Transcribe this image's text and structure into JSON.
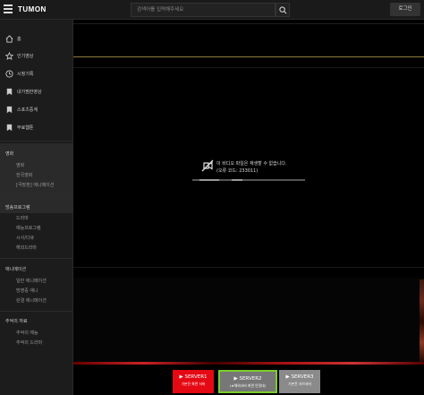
{
  "header": {
    "logo": "TUMON",
    "search_placeholder": "검색어를 입력해주세요",
    "login": "로그인"
  },
  "sidebar": {
    "items": [
      {
        "label": "홈",
        "icon": "home-icon"
      },
      {
        "label": "인기영상",
        "icon": "star-icon"
      },
      {
        "label": "시청기록",
        "icon": "clock-icon"
      },
      {
        "label": "내가찜한영상",
        "icon": "bookmark-icon"
      },
      {
        "label": "스포츠중계",
        "icon": "bookmark-icon"
      },
      {
        "label": "무료웹툰",
        "icon": "bookmark-icon"
      }
    ],
    "sections": [
      {
        "title": "영화",
        "items": [
          "영화",
          "한국영화",
          "[극장판] 애니메이션"
        ]
      },
      {
        "title": "방송프로그램",
        "items": [
          "드라마",
          "예능프로그램",
          "시사/다큐",
          "해외드라마"
        ]
      },
      {
        "title": "애니메이션",
        "items": [
          "일반 애니메이션",
          "방영중 애니",
          "완결 애니메이션"
        ]
      },
      {
        "title": "추억의 자료",
        "items": [
          "추억의 예능",
          "추억의 드라마"
        ]
      }
    ]
  },
  "player": {
    "error_line1": "이 비디오 파일은 재생할 수 없습니다.",
    "error_line2": "(오류 코드: 233011)"
  },
  "servers": [
    {
      "label": "SERVER1",
      "sub": "기본전 화면 서버"
    },
    {
      "label": "SERVER2",
      "sub": "(★해외서버 화면 안정대)"
    },
    {
      "label": "SERVER3",
      "sub": "기본전 서브서버"
    }
  ],
  "colors": {
    "server1": "#e50914",
    "server2_border": "#7ccc2c",
    "divider_yellow": "#8a7a3a"
  }
}
